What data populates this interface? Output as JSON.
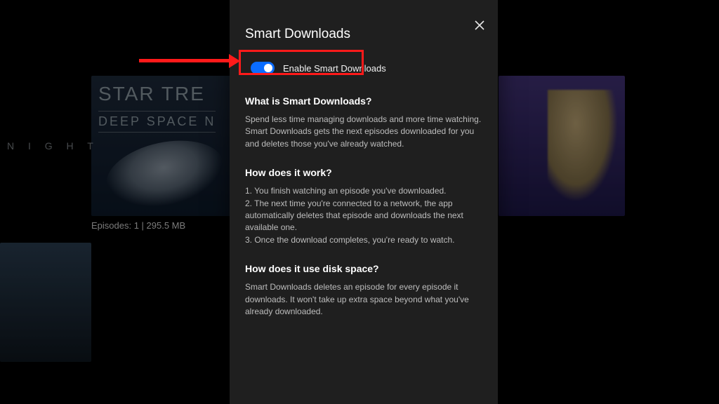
{
  "background": {
    "left_word": "N I G H T",
    "title_line1": "STAR TRE",
    "title_line2": "DEEP SPACE N",
    "episodes_label": "Episodes: 1 | 295.5 MB"
  },
  "dialog": {
    "title": "Smart Downloads",
    "close_tooltip": "Close",
    "toggle": {
      "label": "Enable Smart Downloads",
      "on": true
    },
    "sections": {
      "what": {
        "heading": "What is Smart Downloads?",
        "body": "Spend less time managing downloads and more time watching. Smart Downloads gets the next episodes downloaded for you and deletes those you've already watched."
      },
      "how": {
        "heading": "How does it work?",
        "item1": "1. You finish watching an episode you've downloaded.",
        "item2": "2. The next time you're connected to a network, the app automatically deletes that episode and downloads the next available one.",
        "item3": "3. Once the download completes, you're ready to watch."
      },
      "disk": {
        "heading": "How does it use disk space?",
        "body": "Smart Downloads deletes an episode for every episode it downloads. It won't take up extra space beyond what you've already downloaded."
      }
    }
  },
  "callout": {
    "color": "#ff1a1a"
  }
}
